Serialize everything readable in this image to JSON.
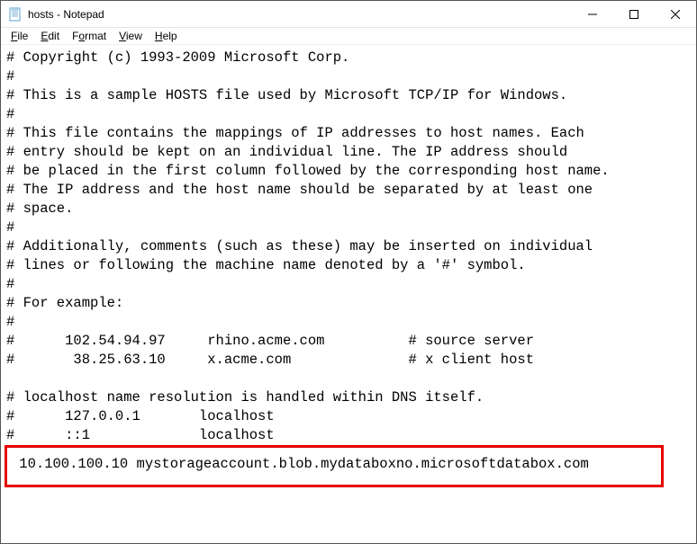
{
  "window": {
    "title": "hosts - Notepad"
  },
  "menubar": {
    "file": "File",
    "edit": "Edit",
    "format": "Format",
    "view": "View",
    "help": "Help"
  },
  "content": {
    "body": "# Copyright (c) 1993-2009 Microsoft Corp.\n#\n# This is a sample HOSTS file used by Microsoft TCP/IP for Windows.\n#\n# This file contains the mappings of IP addresses to host names. Each\n# entry should be kept on an individual line. The IP address should\n# be placed in the first column followed by the corresponding host name.\n# The IP address and the host name should be separated by at least one\n# space.\n#\n# Additionally, comments (such as these) may be inserted on individual\n# lines or following the machine name denoted by a '#' symbol.\n#\n# For example:\n#\n#      102.54.94.97     rhino.acme.com          # source server\n#       38.25.63.10     x.acme.com              # x client host\n\n# localhost name resolution is handled within DNS itself.\n#      127.0.0.1       localhost\n#      ::1             localhost",
    "highlighted": " 10.100.100.10 mystorageaccount.blob.mydataboxno.microsoftdatabox.com"
  }
}
